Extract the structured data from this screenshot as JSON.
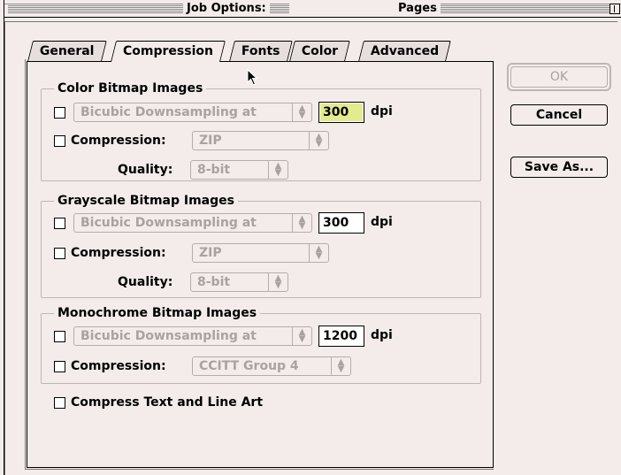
{
  "window": {
    "title_left": "Job Options:",
    "title_right": "Pages"
  },
  "tabs": [
    {
      "label": "General",
      "active": false
    },
    {
      "label": "Compression",
      "active": true
    },
    {
      "label": "Fonts",
      "active": false
    },
    {
      "label": "Color",
      "active": false
    },
    {
      "label": "Advanced",
      "active": false
    }
  ],
  "color_bitmap": {
    "title": "Color Bitmap Images",
    "downsampling": "Bicubic Downsampling at",
    "dpi_value": "300",
    "dpi_unit": "dpi",
    "compression_label": "Compression:",
    "compression_value": "ZIP",
    "quality_label": "Quality:",
    "quality_value": "8-bit"
  },
  "grayscale_bitmap": {
    "title": "Grayscale Bitmap Images",
    "downsampling": "Bicubic Downsampling at",
    "dpi_value": "300",
    "dpi_unit": "dpi",
    "compression_label": "Compression:",
    "compression_value": "ZIP",
    "quality_label": "Quality:",
    "quality_value": "8-bit"
  },
  "monochrome_bitmap": {
    "title": "Monochrome Bitmap Images",
    "downsampling": "Bicubic Downsampling at",
    "dpi_value": "1200",
    "dpi_unit": "dpi",
    "compression_label": "Compression:",
    "compression_value": "CCITT Group 4"
  },
  "compress_text": {
    "label": "Compress Text and Line Art"
  },
  "buttons": {
    "ok": "OK",
    "cancel": "Cancel",
    "save_as": "Save As..."
  },
  "colors": {
    "background": "#f3ecea",
    "focused_field": "#e4eb8f",
    "disabled_text": "#a8a2a0"
  }
}
